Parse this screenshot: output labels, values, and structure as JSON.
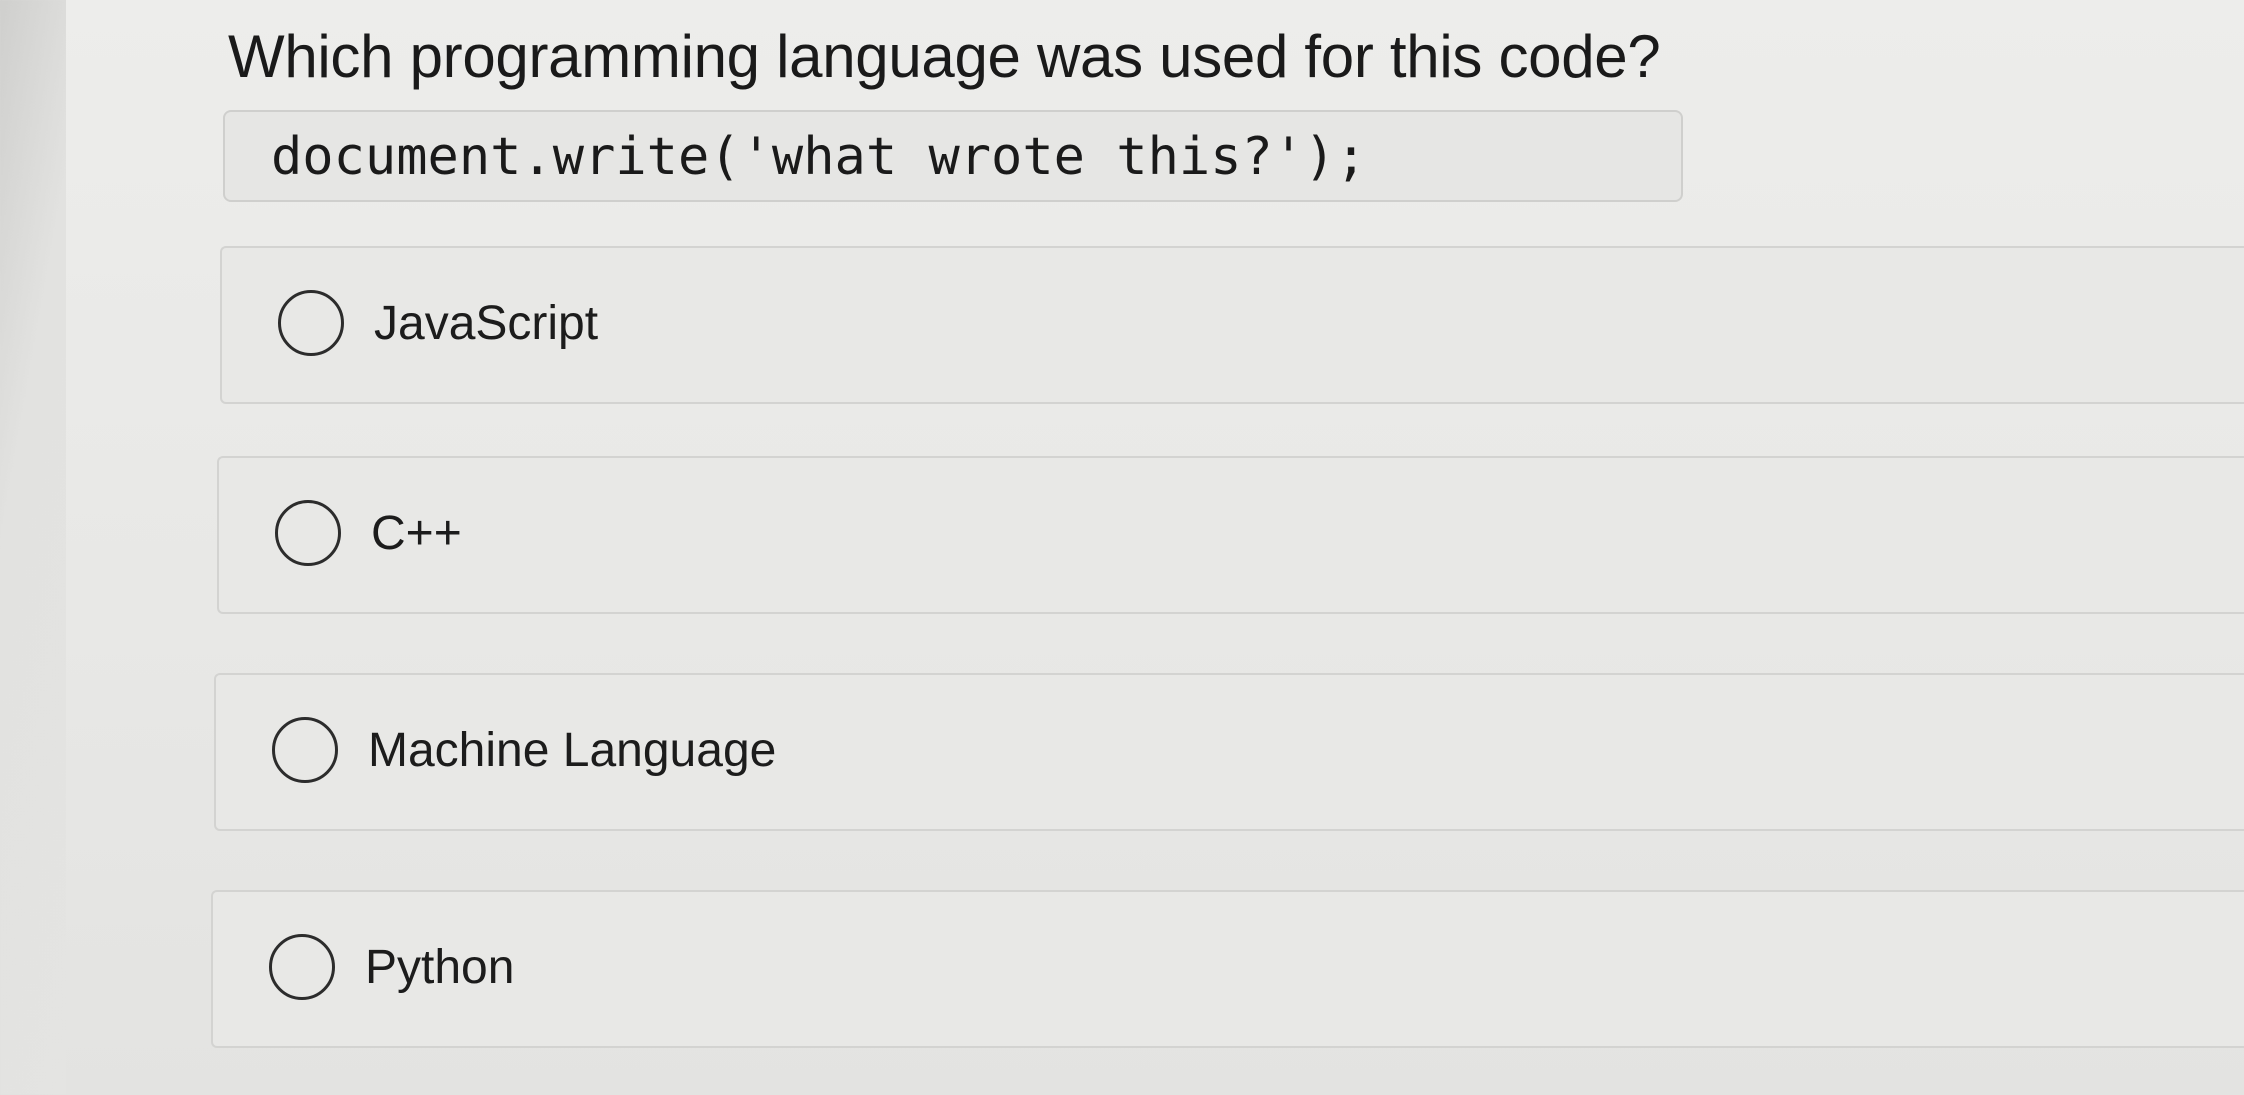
{
  "quiz": {
    "question": "Which programming language was used for this code?",
    "code": "document.write('what wrote this?');",
    "options": [
      {
        "label": "JavaScript",
        "selected": false
      },
      {
        "label": "C++",
        "selected": false
      },
      {
        "label": "Machine Language",
        "selected": false
      },
      {
        "label": "Python",
        "selected": false
      }
    ]
  }
}
